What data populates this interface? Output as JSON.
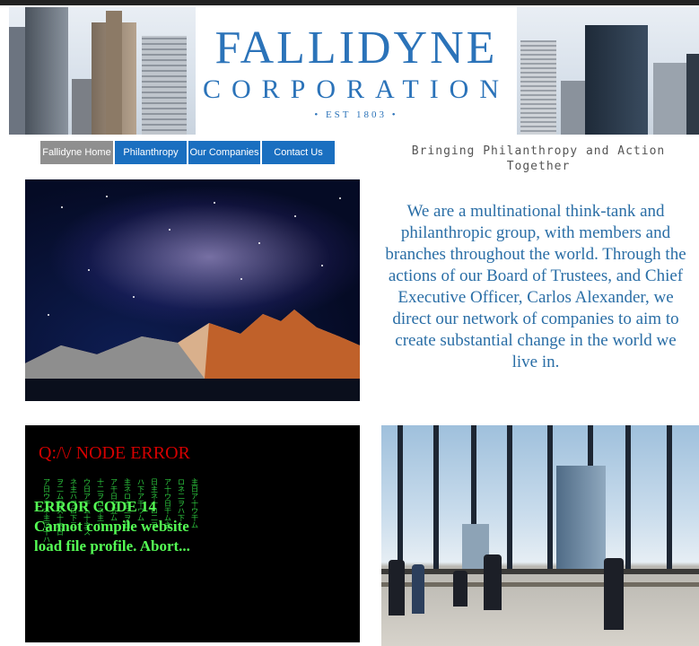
{
  "header": {
    "logo_main": "FALLIDYNE",
    "logo_sub": "CORPORATION",
    "logo_est": "• EST 1803 •"
  },
  "nav": {
    "items": [
      {
        "label": "Fallidyne Home",
        "active": true
      },
      {
        "label": "Philanthropy",
        "active": false
      },
      {
        "label": "Our Companies",
        "active": false
      },
      {
        "label": "Contact Us",
        "active": false
      }
    ]
  },
  "tagline": "Bringing Philanthropy and Action Together",
  "intro": "We are a multinational think-tank and philanthropic group, with members and branches throughout the world. Through the actions of our Board of Trustees, and Chief Executive Officer, Carlos Alexander, we direct our network of companies to aim to create substantial change in the world we live in.",
  "error_panel": {
    "title": "Q:/\\/ NODE ERROR",
    "body": "ERROR CODE 14 Cannot compile website load file profile. Abort..."
  },
  "colors": {
    "brand_blue": "#2b73b9",
    "nav_blue": "#1a6fc0",
    "nav_active": "#8f8f8f",
    "error_red": "#d40000",
    "matrix_green": "#55ff55"
  },
  "images": [
    "galaxy-mountain-photo",
    "office-window-photo"
  ]
}
